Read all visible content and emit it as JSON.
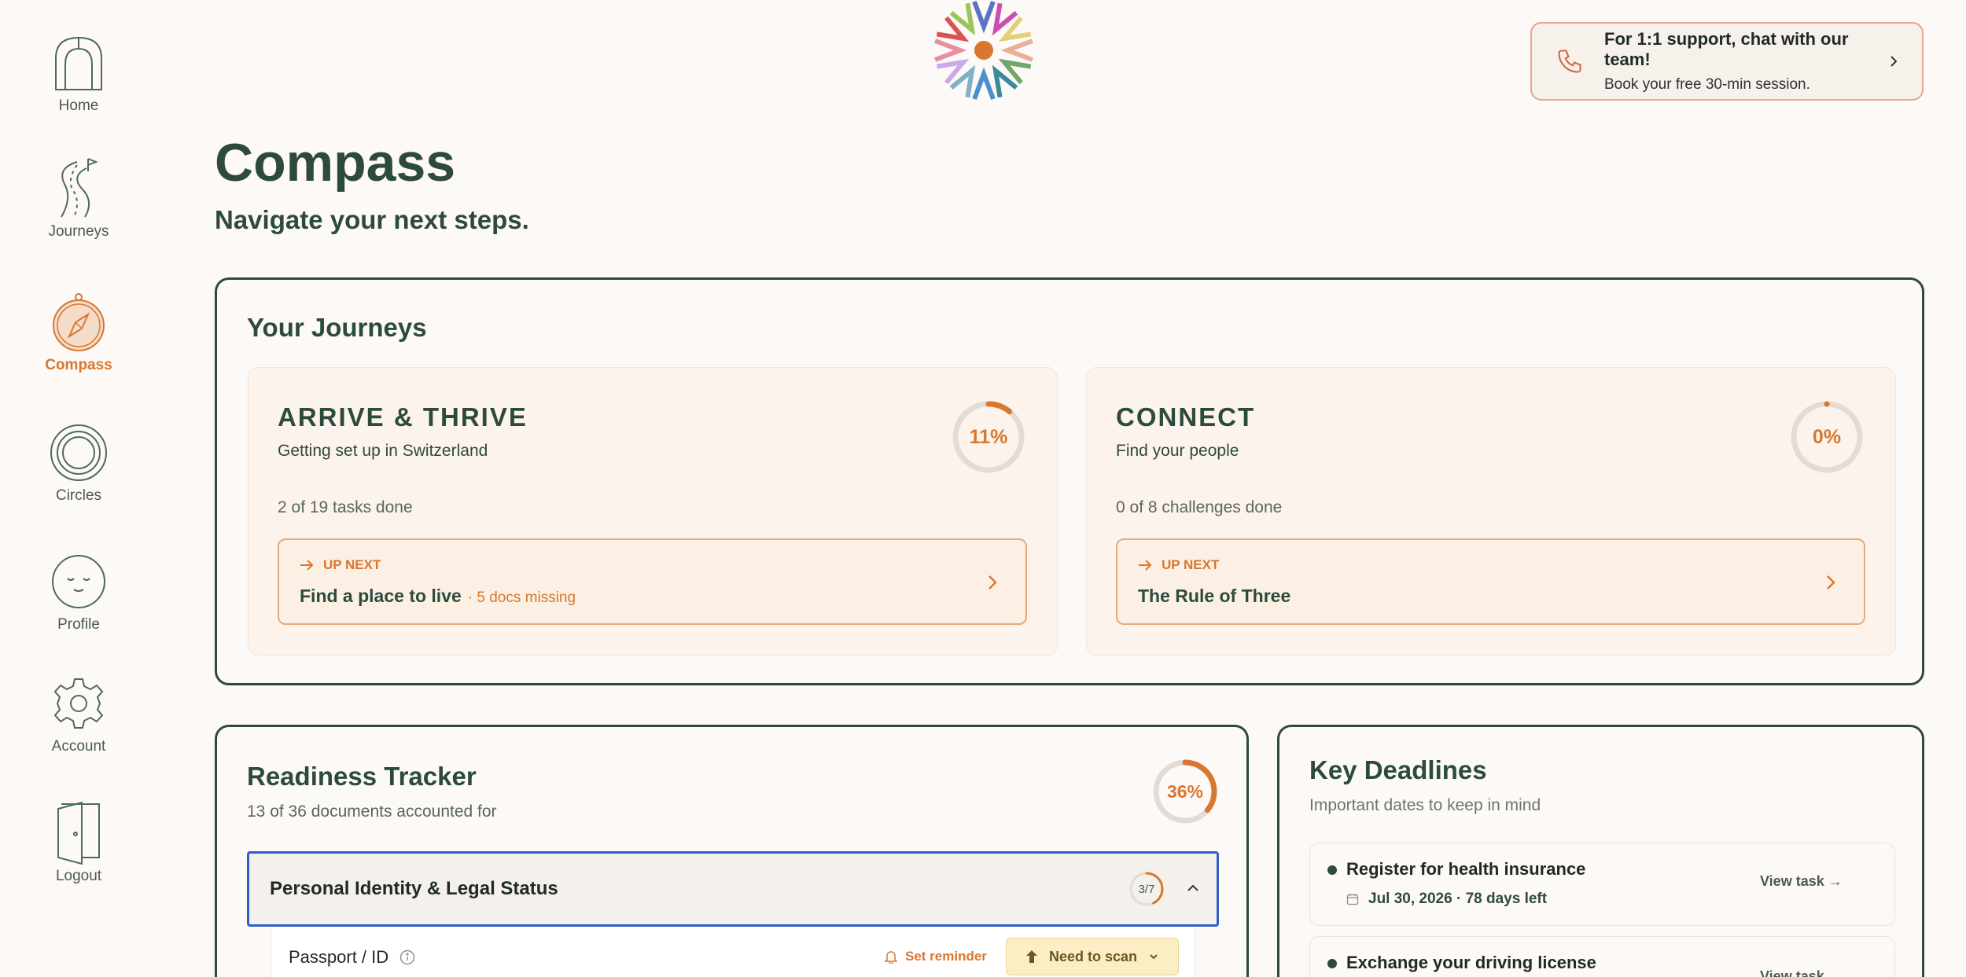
{
  "sidebar": {
    "items": [
      {
        "label": "Home",
        "icon": "home-icon"
      },
      {
        "label": "Journeys",
        "icon": "road-icon"
      },
      {
        "label": "Compass",
        "icon": "compass-icon"
      },
      {
        "label": "Circles",
        "icon": "circles-icon"
      },
      {
        "label": "Profile",
        "icon": "face-icon"
      },
      {
        "label": "Account",
        "icon": "gear-icon"
      },
      {
        "label": "Logout",
        "icon": "door-icon"
      }
    ],
    "active": "Compass"
  },
  "support": {
    "title": "For 1:1 support, chat with our team!",
    "subtitle": "Book your free 30-min session."
  },
  "header": {
    "title": "Compass",
    "subtitle": "Navigate your next steps."
  },
  "journeys": {
    "heading": "Your Journeys",
    "cards": [
      {
        "name": "ARRIVE & THRIVE",
        "desc": "Getting set up in Switzerland",
        "percent_label": "11%",
        "progress": 0.11,
        "count": "2 of 19 tasks done",
        "upnext_label": "UP NEXT",
        "upnext_title": "Find a place to live",
        "upnext_note": "· 5 docs missing"
      },
      {
        "name": "CONNECT",
        "desc": "Find your people",
        "percent_label": "0%",
        "progress": 0,
        "count": "0 of 8 challenges done",
        "upnext_label": "UP NEXT",
        "upnext_title": "The Rule of Three",
        "upnext_note": ""
      }
    ]
  },
  "tracker": {
    "heading": "Readiness Tracker",
    "subtitle": "13 of 36 documents accounted for",
    "percent_label": "36%",
    "progress": 0.36,
    "category": {
      "name": "Personal Identity & Legal Status",
      "count_label": "3/7",
      "progress": 0.4286
    },
    "document": {
      "name": "Passport / ID",
      "reminder_label": "Set reminder",
      "status_label": "Need to scan"
    }
  },
  "deadlines": {
    "heading": "Key Deadlines",
    "subtitle": "Important dates to keep in mind",
    "items": [
      {
        "title": "Register for health insurance",
        "date": "Jul 30, 2026 · 78 days left",
        "action": "View task →"
      },
      {
        "title": "Exchange your driving license",
        "date": "",
        "action": "View task →"
      }
    ]
  },
  "colors": {
    "primary": "#2d4a3e",
    "accent": "#d8772f",
    "background": "#fdf9f6",
    "focus": "#2e5fc7"
  }
}
